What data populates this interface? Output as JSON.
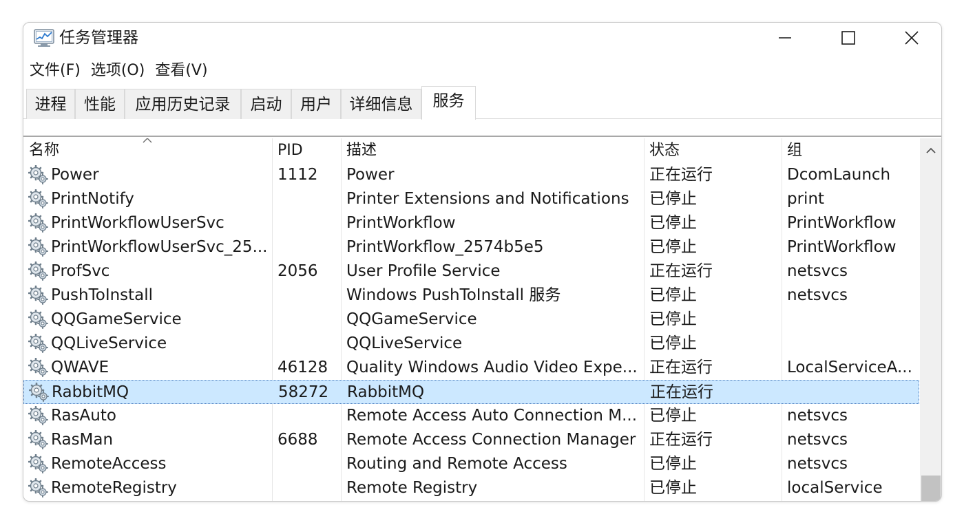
{
  "window": {
    "title": "任务管理器",
    "icon": "task-manager-icon"
  },
  "window_controls": {
    "minimize_icon": "minimize-icon",
    "maximize_icon": "maximize-icon",
    "close_icon": "close-icon"
  },
  "menu": {
    "file": "文件(F)",
    "options": "选项(O)",
    "view": "查看(V)"
  },
  "tabs": [
    {
      "label": "进程"
    },
    {
      "label": "性能"
    },
    {
      "label": "应用历史记录"
    },
    {
      "label": "启动"
    },
    {
      "label": "用户"
    },
    {
      "label": "详细信息"
    },
    {
      "label": "服务",
      "active": true
    }
  ],
  "table": {
    "headers": {
      "name": "名称",
      "pid": "PID",
      "description": "描述",
      "status": "状态",
      "group": "组"
    },
    "sort_column": "name",
    "rows": [
      {
        "name": "Power",
        "pid": "1112",
        "description": "Power",
        "status": "正在运行",
        "group": "DcomLaunch"
      },
      {
        "name": "PrintNotify",
        "pid": "",
        "description": "Printer Extensions and Notifications",
        "status": "已停止",
        "group": "print"
      },
      {
        "name": "PrintWorkflowUserSvc",
        "pid": "",
        "description": "PrintWorkflow",
        "status": "已停止",
        "group": "PrintWorkflow"
      },
      {
        "name": "PrintWorkflowUserSvc_25...",
        "pid": "",
        "description": "PrintWorkflow_2574b5e5",
        "status": "已停止",
        "group": "PrintWorkflow"
      },
      {
        "name": "ProfSvc",
        "pid": "2056",
        "description": "User Profile Service",
        "status": "正在运行",
        "group": "netsvcs"
      },
      {
        "name": "PushToInstall",
        "pid": "",
        "description": "Windows PushToInstall 服务",
        "status": "已停止",
        "group": "netsvcs"
      },
      {
        "name": "QQGameService",
        "pid": "",
        "description": "QQGameService",
        "status": "已停止",
        "group": ""
      },
      {
        "name": "QQLiveService",
        "pid": "",
        "description": "QQLiveService",
        "status": "已停止",
        "group": ""
      },
      {
        "name": "QWAVE",
        "pid": "46128",
        "description": "Quality Windows Audio Video Expe...",
        "status": "正在运行",
        "group": "LocalServiceA..."
      },
      {
        "name": "RabbitMQ",
        "pid": "58272",
        "description": "RabbitMQ",
        "status": "正在运行",
        "group": "",
        "selected": true
      },
      {
        "name": "RasAuto",
        "pid": "",
        "description": "Remote Access Auto Connection M...",
        "status": "已停止",
        "group": "netsvcs"
      },
      {
        "name": "RasMan",
        "pid": "6688",
        "description": "Remote Access Connection Manager",
        "status": "正在运行",
        "group": "netsvcs"
      },
      {
        "name": "RemoteAccess",
        "pid": "",
        "description": "Routing and Remote Access",
        "status": "已停止",
        "group": "netsvcs"
      },
      {
        "name": "RemoteRegistry",
        "pid": "",
        "description": "Remote Registry",
        "status": "已停止",
        "group": "localService"
      }
    ]
  },
  "colors": {
    "selected_row": "#cce8ff",
    "tab_inactive": "#f0f0f0",
    "scrollbar_thumb": "#c2c2c2"
  }
}
